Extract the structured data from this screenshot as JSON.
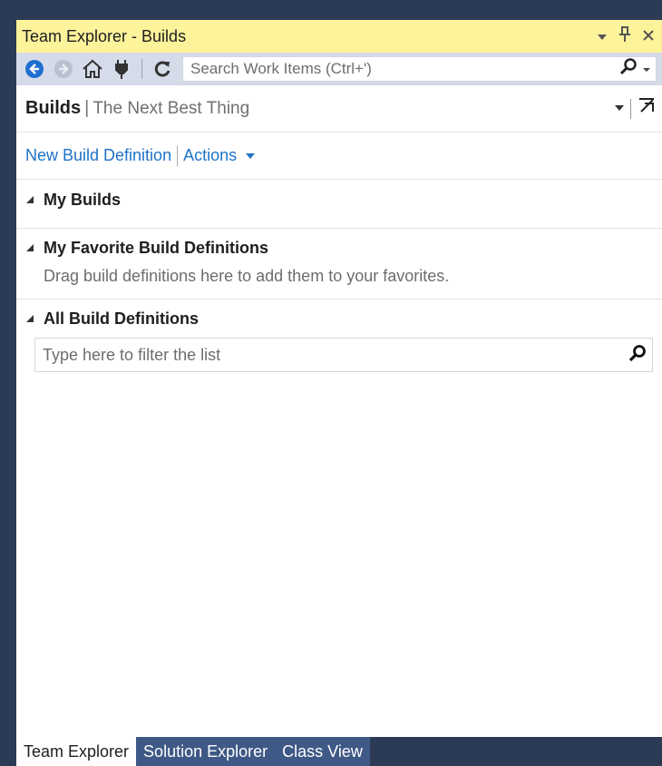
{
  "window": {
    "title": "Team Explorer - Builds",
    "controls": [
      "dropdown-icon",
      "pin-icon",
      "close-icon"
    ]
  },
  "toolbar": {
    "icons": [
      "back-icon",
      "forward-icon",
      "home-icon",
      "connect-icon",
      "refresh-icon"
    ],
    "search_placeholder": "Search Work Items (Ctrl+')"
  },
  "header": {
    "title": "Builds",
    "separator": "|",
    "subtitle": "The Next Best Thing"
  },
  "links": {
    "new_build_definition": "New Build Definition",
    "actions": "Actions"
  },
  "sections": {
    "my_builds": {
      "label": "My Builds"
    },
    "favorites": {
      "label": "My Favorite Build Definitions",
      "hint": "Drag build definitions here to add them to your favorites."
    },
    "all_definitions": {
      "label": "All Build Definitions",
      "filter_placeholder": "Type here to filter the list"
    }
  },
  "tabs": {
    "team_explorer": "Team Explorer",
    "solution_explorer": "Solution Explorer",
    "class_view": "Class View"
  },
  "colors": {
    "title_bar": "#fdf39b",
    "toolbar": "#d6dbe9",
    "link": "#1e73c8",
    "frame": "#2b3a55",
    "inactive_tab": "#3f5986"
  }
}
